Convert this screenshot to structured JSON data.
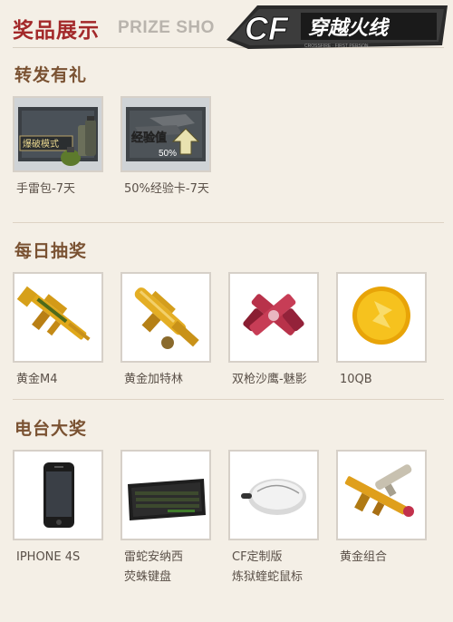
{
  "header": {
    "title_cn": "奖品展示",
    "title_en": "PRIZE SHO",
    "logo_text": "穿越火线",
    "logo_mark": "CF"
  },
  "sections": [
    {
      "title": "转发有礼",
      "items": [
        {
          "label": "手雷包-7天",
          "badge": "爆破模式",
          "icon": "grenade-pack-icon"
        },
        {
          "label": "50%经验卡-7天",
          "badge": "经验值",
          "badge2": "50%",
          "icon": "exp-card-icon"
        }
      ]
    },
    {
      "title": "每日抽奖",
      "items": [
        {
          "label": "黄金M4",
          "icon": "golden-m4-icon"
        },
        {
          "label": "黄金加特林",
          "icon": "golden-gatling-icon"
        },
        {
          "label": "双枪沙鹰-魅影",
          "icon": "dual-desert-eagle-icon"
        },
        {
          "label": "10QB",
          "icon": "qb-coin-icon"
        }
      ]
    },
    {
      "title": "电台大奖",
      "items": [
        {
          "label": "IPHONE 4S",
          "label2": "",
          "icon": "iphone-icon"
        },
        {
          "label": "雷蛇安纳西",
          "label2": "荧蛛键盘",
          "icon": "razer-keyboard-icon"
        },
        {
          "label": "CF定制版",
          "label2": "炼狱蝰蛇鼠标",
          "icon": "razer-mouse-icon"
        },
        {
          "label": "黄金组合",
          "label2": "",
          "icon": "golden-set-icon"
        }
      ]
    }
  ],
  "colors": {
    "background": "#f4efe6",
    "title_red": "#a3292a",
    "section_brown": "#7a5232",
    "gold": "#e0a81a"
  }
}
